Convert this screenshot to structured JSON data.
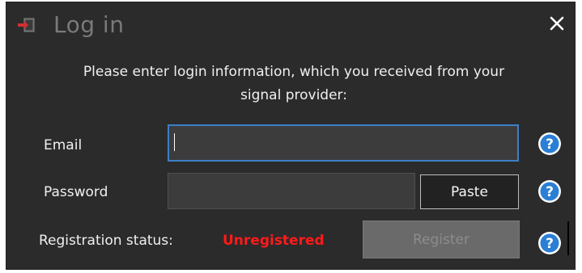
{
  "window": {
    "title": "Log in",
    "title_icon": "login-icon",
    "close_icon": "close-icon"
  },
  "instructions": {
    "line1": "Please enter login information, which you received from your",
    "line2": "signal provider:"
  },
  "email": {
    "label": "Email",
    "value": ""
  },
  "password": {
    "label": "Password",
    "value": "",
    "paste_label": "Paste"
  },
  "registration": {
    "label": "Registration status:",
    "status": "Unregistered",
    "register_label": "Register"
  },
  "help_icon": "help-icon",
  "colors": {
    "background": "#2b2b2b",
    "status_unregistered": "#ff1a1a",
    "focus_border": "#3d7fc7",
    "help_blue": "#2a7fd4"
  }
}
